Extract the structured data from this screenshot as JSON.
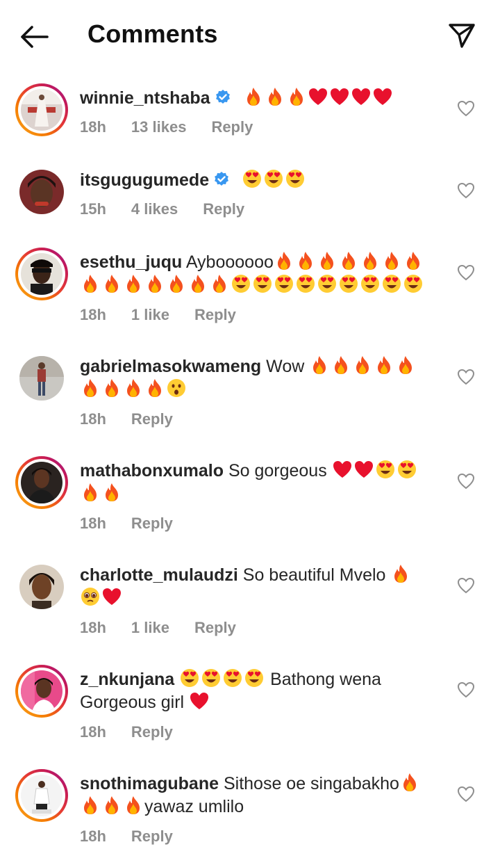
{
  "header": {
    "title": "Comments",
    "back_icon": "arrow-left-icon",
    "send_icon": "paper-plane-icon"
  },
  "colors": {
    "text": "#262626",
    "meta": "#8e8e8e",
    "verified": "#3897f0",
    "story_ring_start": "#f9a825",
    "story_ring_end": "#c2185b"
  },
  "comments": [
    {
      "username": "winnie_ntshaba",
      "verified": true,
      "story_ring": true,
      "line1": "",
      "emojis": [
        "fire",
        "fire",
        "fire",
        "heart",
        "heart",
        "heart",
        "heart"
      ],
      "time": "18h",
      "likes": "13 likes",
      "reply": "Reply"
    },
    {
      "username": "itsgugugumede",
      "verified": true,
      "story_ring": false,
      "line1": "",
      "emojis": [
        "heart-eyes",
        "heart-eyes",
        "heart-eyes"
      ],
      "time": "15h",
      "likes": "4 likes",
      "reply": "Reply"
    },
    {
      "username": "esethu_juqu",
      "verified": false,
      "story_ring": true,
      "line1": "Ayboooooo",
      "emojis": [
        "fire",
        "fire",
        "fire",
        "fire",
        "fire",
        "fire",
        "fire",
        "fire",
        "fire",
        "fire",
        "fire",
        "fire",
        "fire",
        "fire",
        "heart-eyes",
        "heart-eyes",
        "heart-eyes",
        "heart-eyes",
        "heart-eyes",
        "heart-eyes",
        "heart-eyes",
        "heart-eyes",
        "heart-eyes"
      ],
      "time": "18h",
      "likes": "1 like",
      "reply": "Reply"
    },
    {
      "username": "gabrielmasokwameng",
      "verified": false,
      "story_ring": false,
      "line1": "Wow",
      "emojis": [
        "fire",
        "fire",
        "fire",
        "fire",
        "fire",
        "fire",
        "fire",
        "fire",
        "fire",
        "astonished"
      ],
      "time": "18h",
      "likes": "",
      "reply": "Reply"
    },
    {
      "username": "mathabonxumalo",
      "verified": false,
      "story_ring": true,
      "line1": "So gorgeous",
      "emojis": [
        "heart",
        "heart",
        "heart-eyes",
        "heart-eyes",
        "fire",
        "fire"
      ],
      "time": "18h",
      "likes": "",
      "reply": "Reply"
    },
    {
      "username": "charlotte_mulaudzi",
      "verified": false,
      "story_ring": false,
      "line1": "So beautiful Mvelo",
      "emojis": [
        "fire",
        "pleading",
        "heart"
      ],
      "time": "18h",
      "likes": "1 like",
      "reply": "Reply"
    },
    {
      "username": "z_nkunjana",
      "verified": false,
      "story_ring": true,
      "line1": "",
      "emojis": [
        "heart-eyes",
        "heart-eyes",
        "heart-eyes",
        "heart-eyes"
      ],
      "line2": "Bathong wena Gorgeous girl",
      "emojis_after": [
        "heart"
      ],
      "time": "18h",
      "likes": "",
      "reply": "Reply"
    },
    {
      "username": "snothimagubane",
      "verified": false,
      "story_ring": true,
      "line1": "Sithose oe singabakho",
      "emojis": [
        "fire",
        "fire",
        "fire",
        "fire"
      ],
      "line2": "yawaz umlilo",
      "time": "18h",
      "likes": "",
      "reply": "Reply"
    }
  ]
}
